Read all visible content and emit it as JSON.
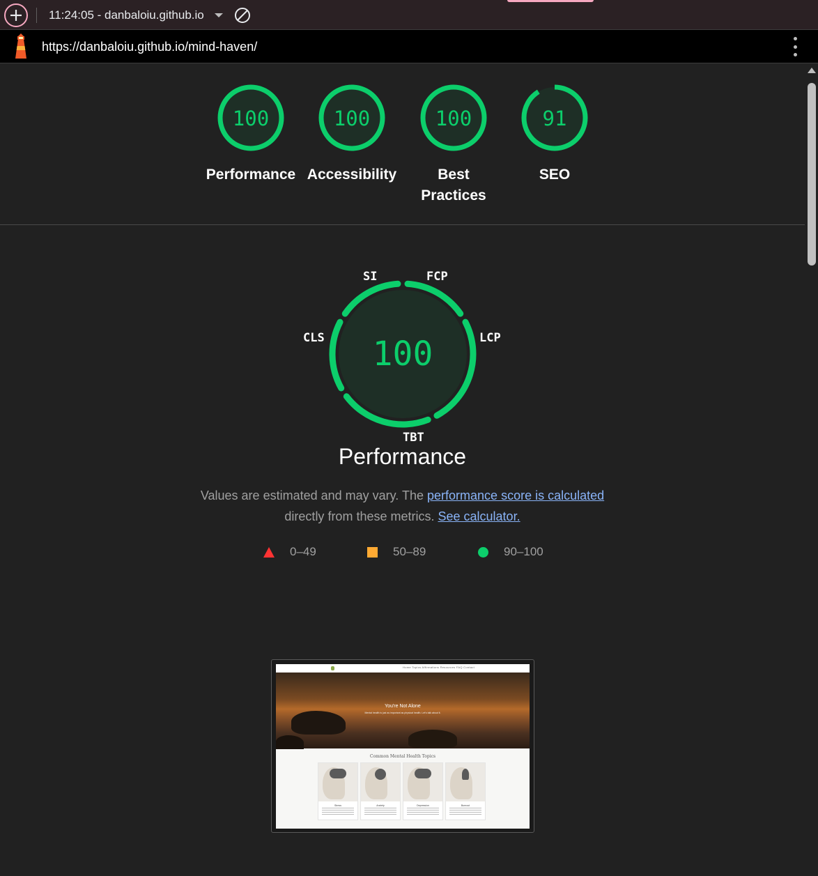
{
  "toolbar": {
    "report_label": "11:24:05 - danbaloiu.github.io",
    "new_report_icon": "plus-icon",
    "block_icon": "no-entry-icon"
  },
  "urlbar": {
    "url": "https://danbaloiu.github.io/mind-haven/",
    "logo_icon": "lighthouse-icon",
    "menu_icon": "kebab-menu-icon"
  },
  "categories": [
    {
      "label": "Performance",
      "score": "100",
      "value": 100
    },
    {
      "label": "Accessibility",
      "score": "100",
      "value": 100
    },
    {
      "label": "Best Practices",
      "score": "100",
      "value": 100
    },
    {
      "label": "SEO",
      "score": "91",
      "value": 91
    }
  ],
  "performance": {
    "score": "100",
    "title": "Performance",
    "metrics": {
      "si": "SI",
      "fcp": "FCP",
      "lcp": "LCP",
      "tbt": "TBT",
      "cls": "CLS"
    },
    "desc_prefix": "Values are estimated and may vary. The ",
    "desc_link": "performance score is calculated",
    "desc_mid": "directly from these metrics.",
    "desc_link2": "See calculator."
  },
  "legend": [
    {
      "range": "0–49",
      "color": "#ff3333"
    },
    {
      "range": "50–89",
      "color": "#ffaa33"
    },
    {
      "range": "90–100",
      "color": "#0cce6b"
    }
  ],
  "colors": {
    "pass": "#0cce6b",
    "gauge_fill": "#1e2f26",
    "background": "#212121"
  },
  "thumbnail": {
    "nav_links": "Home   Topics   Affirmations   Resources   FAQ   Contact",
    "hero_title": "You're Not Alone",
    "hero_subtitle": "Mental health is just as important as physical health. Let's talk about it.",
    "section_heading": "Common Mental Health Topics",
    "cards": [
      "Stress",
      "Anxiety",
      "Depression",
      "Burnout"
    ]
  }
}
